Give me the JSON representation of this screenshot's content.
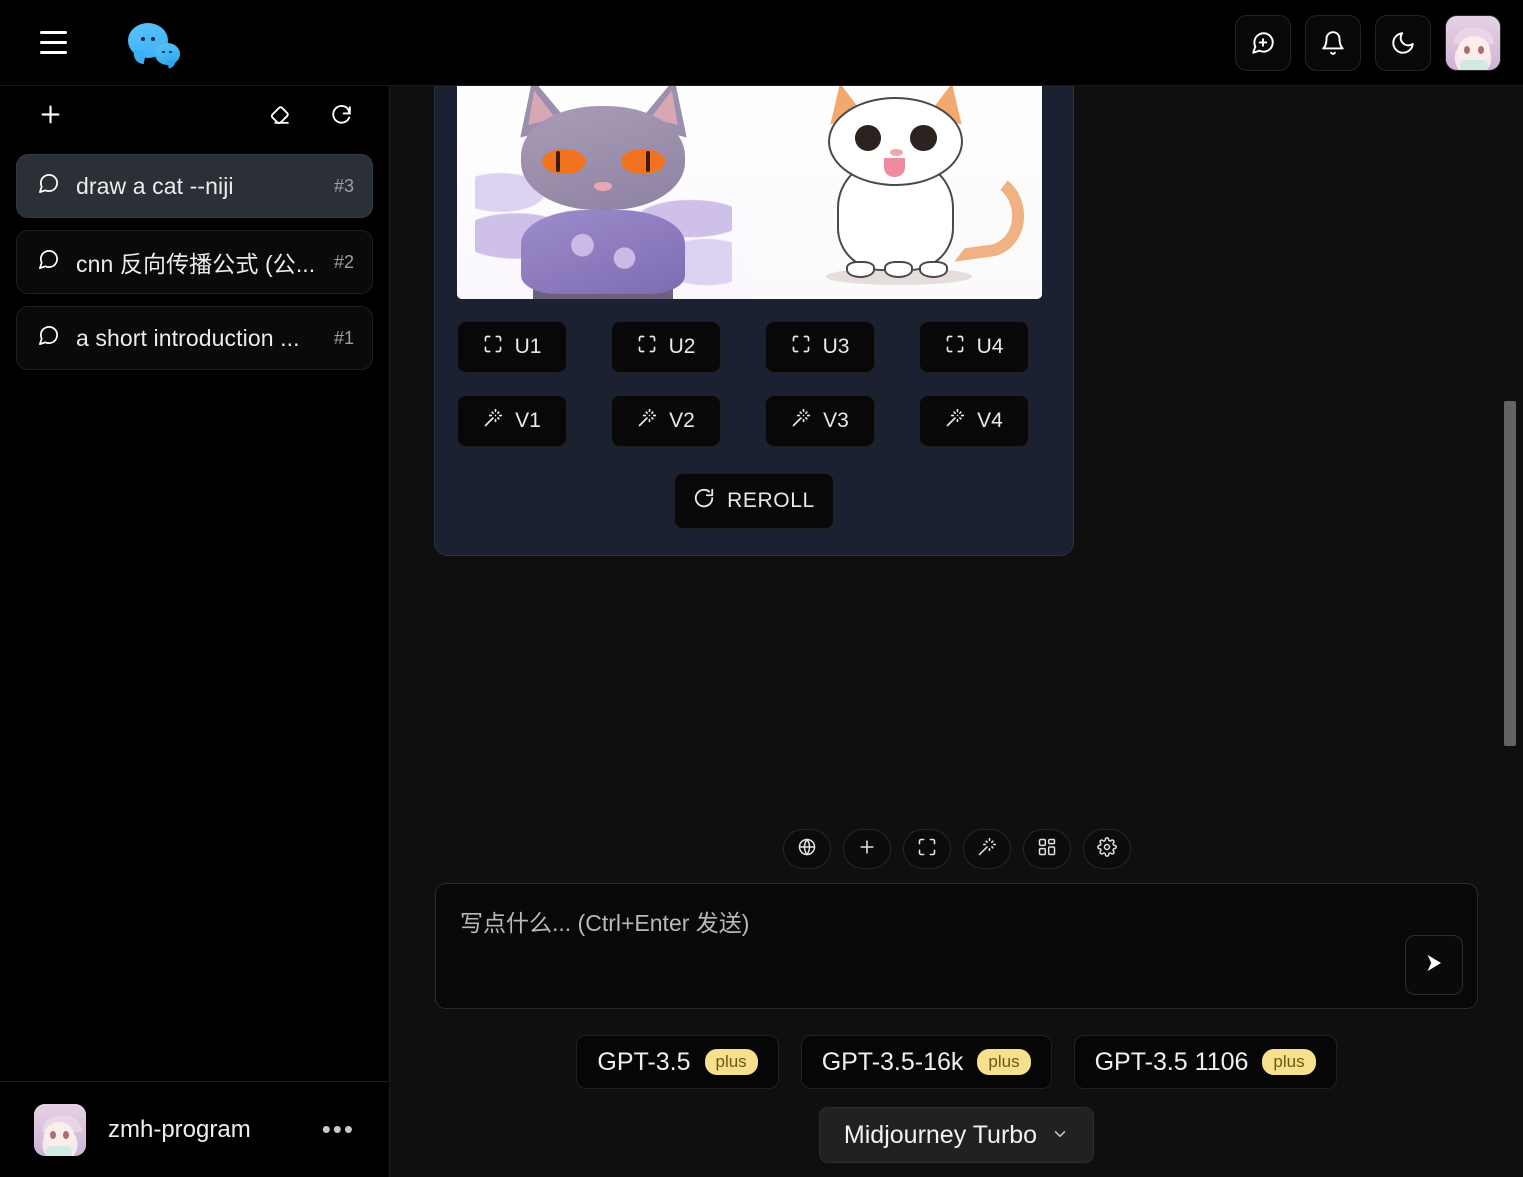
{
  "header": {
    "menu_icon": "hamburger-icon",
    "logo_icon": "chat-bubbles-logo",
    "actions": [
      {
        "name": "new-chat",
        "icon": "message-plus-icon"
      },
      {
        "name": "notifications",
        "icon": "bell-icon"
      },
      {
        "name": "theme-toggle",
        "icon": "moon-icon"
      },
      {
        "name": "profile",
        "icon": "avatar"
      }
    ]
  },
  "sidebar": {
    "new_chat_icon": "plus-icon",
    "clear_icon": "eraser-icon",
    "refresh_icon": "refresh-icon",
    "items": [
      {
        "title": "draw a cat --niji",
        "count": "#3",
        "icon": "chat-icon",
        "active": true
      },
      {
        "title": "cnn 反向传播公式 (公...",
        "count": "#2",
        "icon": "chat-icon",
        "active": false
      },
      {
        "title": "a short introduction ...",
        "count": "#1",
        "icon": "chat-icon",
        "active": false
      }
    ],
    "user": {
      "name": "zmh-program",
      "more_label": "•••"
    }
  },
  "message": {
    "image_alt": "midjourney-cat-grid",
    "upscale_buttons": [
      {
        "label": "U1",
        "icon": "scan-icon"
      },
      {
        "label": "U2",
        "icon": "scan-icon"
      },
      {
        "label": "U3",
        "icon": "scan-icon"
      },
      {
        "label": "U4",
        "icon": "scan-icon"
      }
    ],
    "variation_buttons": [
      {
        "label": "V1",
        "icon": "magic-wand-icon"
      },
      {
        "label": "V2",
        "icon": "magic-wand-icon"
      },
      {
        "label": "V3",
        "icon": "magic-wand-icon"
      },
      {
        "label": "V4",
        "icon": "magic-wand-icon"
      }
    ],
    "reroll": {
      "label": "REROLL",
      "icon": "refresh-icon"
    },
    "more_menu_icon": "more-vertical-icon"
  },
  "composer": {
    "tools": [
      {
        "name": "web-search",
        "icon": "globe-icon"
      },
      {
        "name": "add-attachment",
        "icon": "plus-icon"
      },
      {
        "name": "fullscreen",
        "icon": "scan-icon"
      },
      {
        "name": "magic",
        "icon": "magic-wand-icon"
      },
      {
        "name": "apps",
        "icon": "grid-apps-icon"
      },
      {
        "name": "settings",
        "icon": "gear-icon"
      }
    ],
    "input": {
      "placeholder": "写点什么... (Ctrl+Enter 发送)",
      "value": ""
    },
    "send_icon": "send-icon",
    "models": [
      {
        "label": "GPT-3.5",
        "badge": "plus"
      },
      {
        "label": "GPT-3.5-16k",
        "badge": "plus"
      },
      {
        "label": "GPT-3.5 1106",
        "badge": "plus"
      }
    ],
    "model_select": {
      "value": "Midjourney Turbo",
      "chevron_icon": "chevron-down-icon"
    }
  },
  "colors": {
    "accent_blue": "#3bb0f5",
    "badge_yellow": "#f7e08d",
    "bubble_bg": "#1b2130",
    "sidebar_active": "#2b2f36"
  }
}
